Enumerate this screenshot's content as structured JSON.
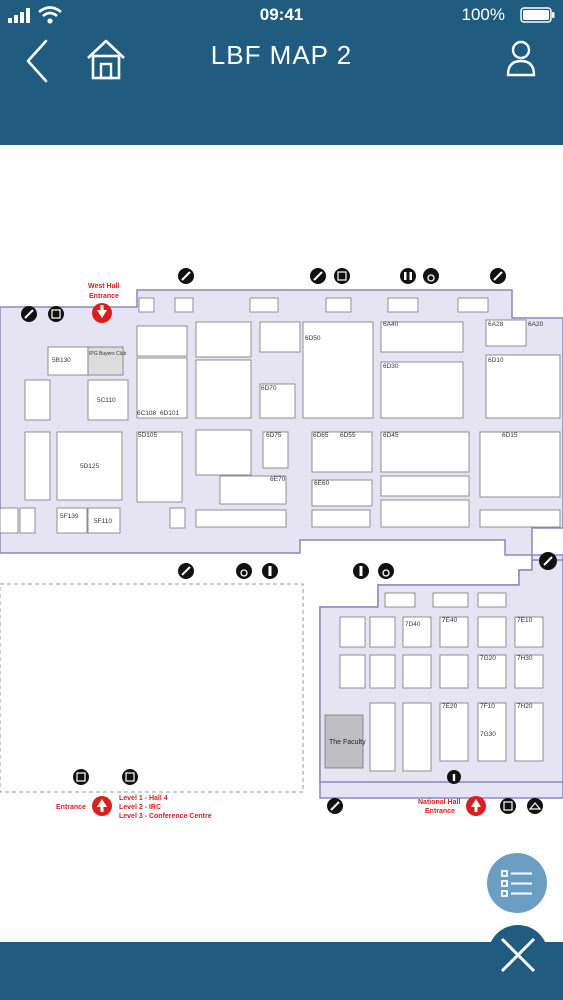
{
  "status_bar": {
    "time": "09:41",
    "battery": "100%",
    "icons": [
      "signal-icon",
      "wifi-icon",
      "battery-icon"
    ]
  },
  "nav": {
    "title": "LBF MAP 2",
    "icons": [
      "back-icon",
      "home-icon",
      "user-icon"
    ]
  },
  "map": {
    "labels": {
      "west_hall_entrance_1": "West Hall",
      "west_hall_entrance_2": "Entrance",
      "entrance": "Entrance",
      "levels_1": "Level 1 - Hall 4",
      "levels_2": "Level 2 - IRC",
      "levels_3": "Level 3 - Conference Centre",
      "national_hall_1": "National Hall",
      "national_hall_2": "Entrance",
      "the_faculty": "The Faculty",
      "ipg_club": "IPG Buyers Club"
    },
    "stands": [
      "5B130",
      "5C110",
      "5D125",
      "5F110",
      "5F139",
      "5D105",
      "5C108",
      "5C100",
      "6C108",
      "6D101",
      "6D105",
      "6D70",
      "6D75",
      "6D65",
      "6D55",
      "6D45",
      "6D50",
      "6D30",
      "6D10",
      "6D15",
      "6E70",
      "6E60",
      "6A28",
      "6A20",
      "6A10",
      "6A40",
      "6A30",
      "7D40",
      "7E40",
      "7E30",
      "7E20",
      "7E10",
      "7F30",
      "7F20",
      "7F10",
      "7G30",
      "7G20",
      "7H30",
      "7H20",
      "7D15",
      "7C20",
      "7F26"
    ],
    "colors": {
      "hall_fill": "#e6e4f2",
      "hall_outline": "#8c87bd",
      "entrance_red": "#d8201f",
      "faculty_grey": "#bfbfc3"
    }
  },
  "colors": {
    "header": "#1f5c80",
    "fab_light": "#6b9ec2"
  },
  "fab": {
    "icons": [
      "list-icon",
      "close-icon"
    ]
  }
}
